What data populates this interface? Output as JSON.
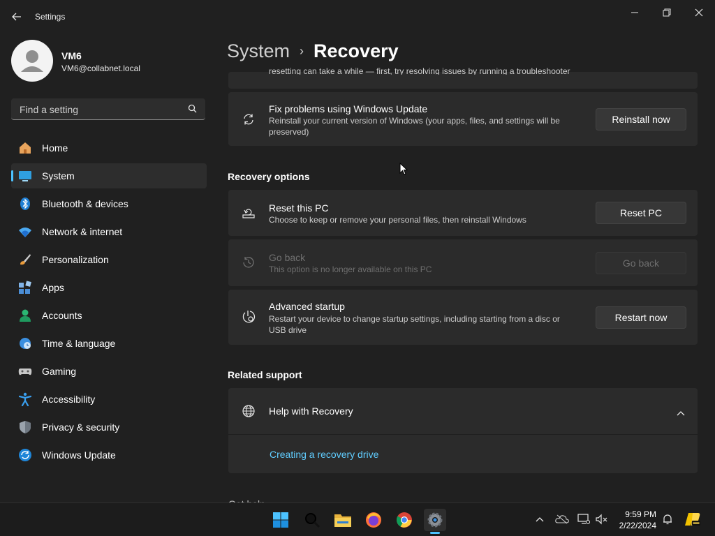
{
  "window": {
    "app_title": "Settings"
  },
  "user": {
    "name": "VM6",
    "email": "VM6@collabnet.local"
  },
  "search": {
    "placeholder": "Find a setting"
  },
  "nav": {
    "items": [
      {
        "label": "Home",
        "icon": "home-icon"
      },
      {
        "label": "System",
        "icon": "system-icon",
        "active": true
      },
      {
        "label": "Bluetooth & devices",
        "icon": "bluetooth-icon"
      },
      {
        "label": "Network & internet",
        "icon": "network-icon"
      },
      {
        "label": "Personalization",
        "icon": "personalization-icon"
      },
      {
        "label": "Apps",
        "icon": "apps-icon"
      },
      {
        "label": "Accounts",
        "icon": "accounts-icon"
      },
      {
        "label": "Time & language",
        "icon": "time-language-icon"
      },
      {
        "label": "Gaming",
        "icon": "gaming-icon"
      },
      {
        "label": "Accessibility",
        "icon": "accessibility-icon"
      },
      {
        "label": "Privacy & security",
        "icon": "privacy-icon"
      },
      {
        "label": "Windows Update",
        "icon": "windows-update-icon"
      }
    ]
  },
  "header": {
    "parent": "System",
    "separator": "›",
    "current": "Recovery"
  },
  "content": {
    "cut_off_text": "resetting can take a while — first, try resolving issues by running a troubleshooter",
    "fix_problems": {
      "title": "Fix problems using Windows Update",
      "description": "Reinstall your current version of Windows (your apps, files, and settings will be preserved)",
      "button": "Reinstall now",
      "icon": "sync-icon"
    },
    "recovery_options_title": "Recovery options",
    "reset_pc": {
      "title": "Reset this PC",
      "description": "Choose to keep or remove your personal files, then reinstall Windows",
      "button": "Reset PC",
      "icon": "reset-pc-icon"
    },
    "go_back": {
      "title": "Go back",
      "description": "This option is no longer available on this PC",
      "button": "Go back",
      "icon": "history-icon",
      "disabled": true
    },
    "advanced_startup": {
      "title": "Advanced startup",
      "description": "Restart your device to change startup settings, including starting from a disc or USB drive",
      "button": "Restart now",
      "icon": "advanced-startup-icon"
    },
    "related_support_title": "Related support",
    "help": {
      "title": "Help with Recovery",
      "link": "Creating a recovery drive",
      "icon": "globe-icon"
    },
    "partial_footer": "Get help"
  },
  "taskbar": {
    "apps": [
      "start-icon",
      "search-icon",
      "file-explorer-icon",
      "firefox-icon",
      "chrome-icon",
      "settings-icon"
    ],
    "time": "9:59 PM",
    "date": "2/22/2024"
  },
  "colors": {
    "background": "#202020",
    "card": "#2b2b2b",
    "accent": "#4cc2ff",
    "link": "#60cdff"
  }
}
